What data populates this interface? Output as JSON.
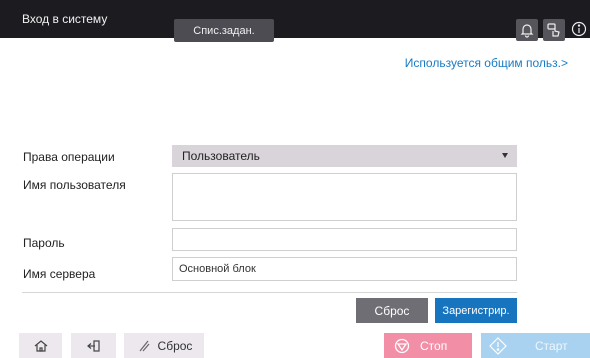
{
  "header": {
    "title": "Вход в систему",
    "job_list_label": "Спис.задан.",
    "icons": [
      "bell-icon",
      "hand-touch-icon",
      "info-icon"
    ]
  },
  "shared_link": "Используется общим польз.>",
  "form": {
    "operation_rights_label": "Права операции",
    "operation_rights_value": "Пользователь",
    "username_label": "Имя пользователя",
    "username_value": "",
    "password_label": "Пароль",
    "password_value": "",
    "server_label": "Имя сервера",
    "server_value": "Основной блок"
  },
  "actions": {
    "reset_label": "Сброс",
    "register_label": "Зарегистрир."
  },
  "bottom": {
    "reset_label": "Сброс",
    "stop_label": "Стоп",
    "start_label": "Старт"
  },
  "colors": {
    "header_bg": "#1b1b20",
    "link": "#1a7bc4",
    "register": "#1774bf",
    "stop": "#f28fa6",
    "start": "#a9d2f0"
  }
}
